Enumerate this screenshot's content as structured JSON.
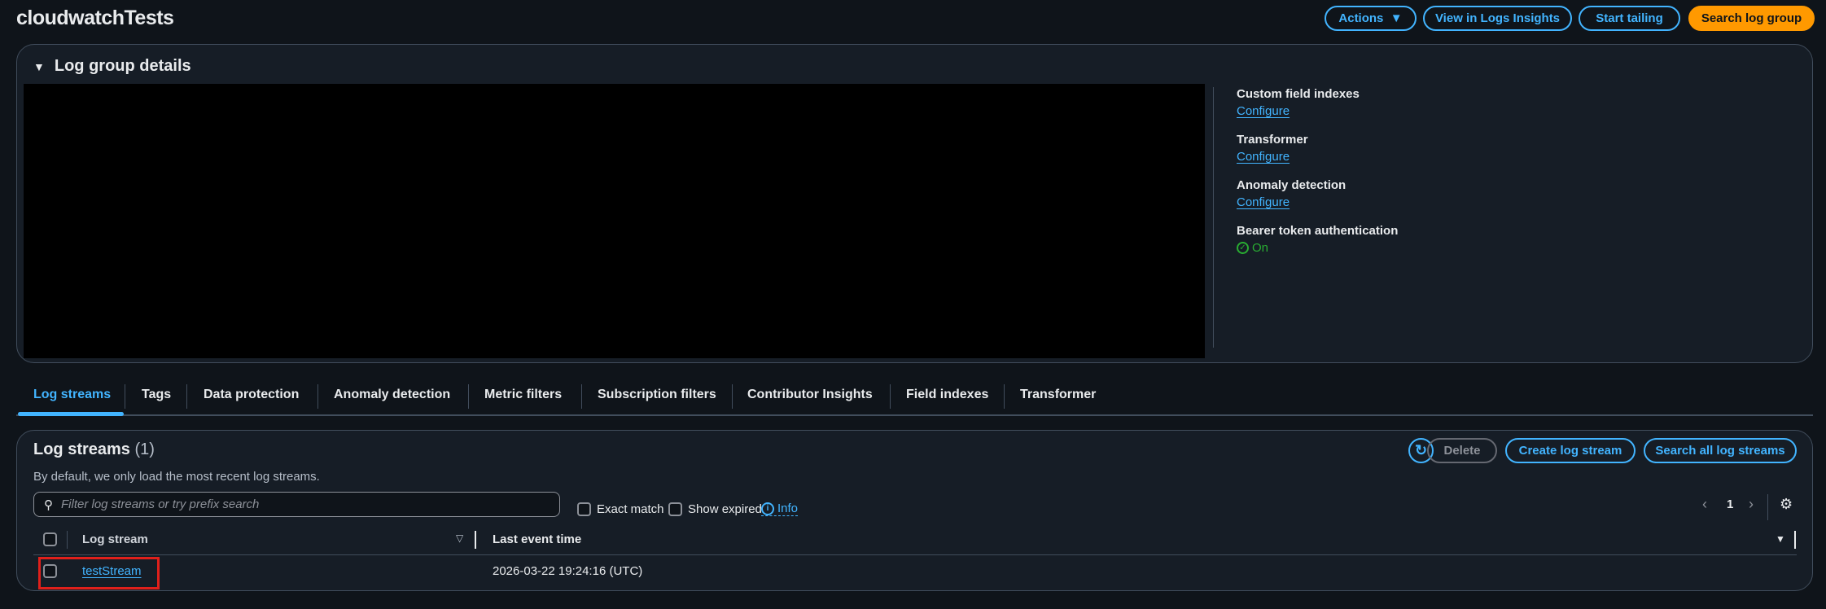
{
  "header": {
    "title": "cloudwatchTests",
    "actions": "Actions",
    "view_insights": "View in Logs Insights",
    "start_tailing": "Start tailing",
    "search_group": "Search log group"
  },
  "details": {
    "heading": "Log group details",
    "items": [
      {
        "label": "Custom field indexes",
        "value": "Configure"
      },
      {
        "label": "Transformer",
        "value": "Configure"
      },
      {
        "label": "Anomaly detection",
        "value": "Configure"
      },
      {
        "label": "Bearer token authentication",
        "value": "On"
      }
    ]
  },
  "tabs": [
    "Log streams",
    "Tags",
    "Data protection",
    "Anomaly detection",
    "Metric filters",
    "Subscription filters",
    "Contributor Insights",
    "Field indexes",
    "Transformer"
  ],
  "streams": {
    "title": "Log streams",
    "count": "(1)",
    "subtitle": "By default, we only load the most recent log streams.",
    "delete": "Delete",
    "create": "Create log stream",
    "search_all": "Search all log streams",
    "filter_placeholder": "Filter log streams or try prefix search",
    "exact_match": "Exact match",
    "show_expired": "Show expired",
    "info": "Info",
    "page": "1",
    "columns": [
      "Log stream",
      "Last event time"
    ],
    "rows": [
      {
        "name": "testStream",
        "time": "2026-03-22 19:24:16 (UTC)"
      }
    ]
  },
  "colors": {
    "accent": "#42b4ff",
    "primary": "#ff9900",
    "success": "#29ad32",
    "highlight": "#e0201b"
  }
}
